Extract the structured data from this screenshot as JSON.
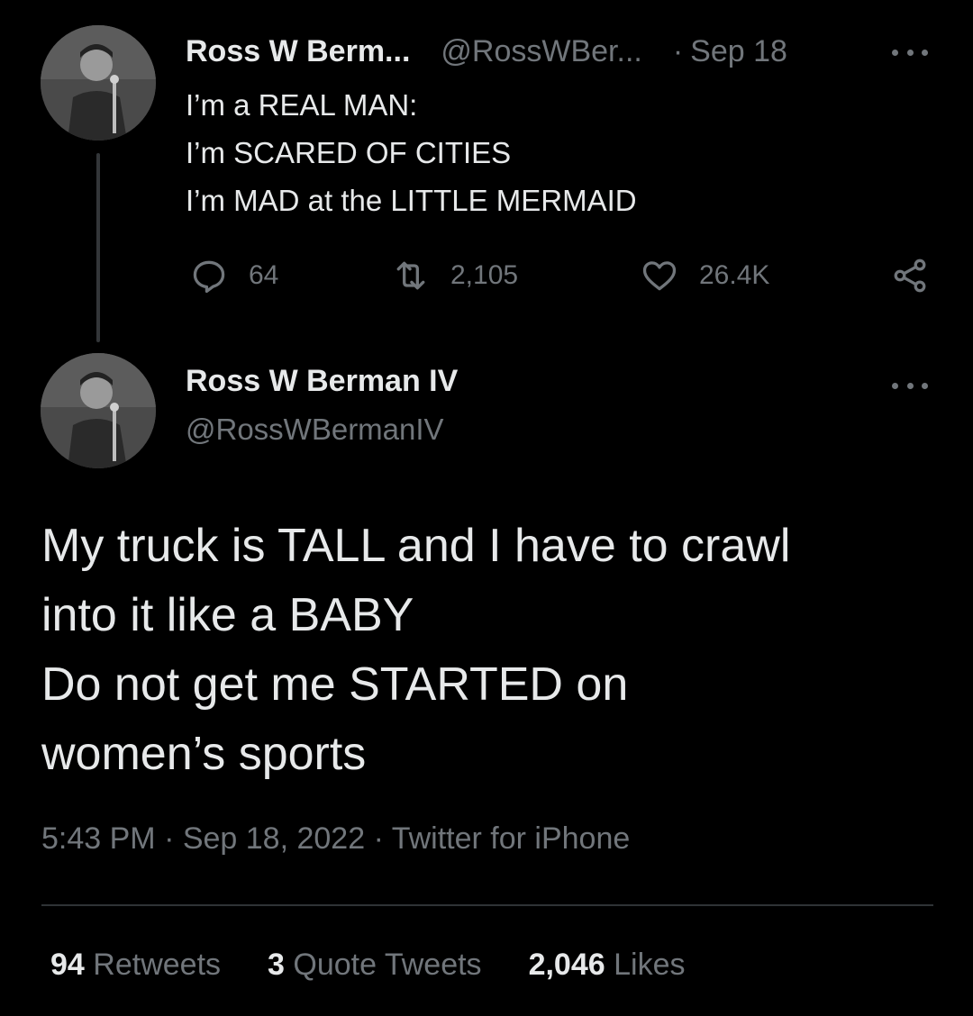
{
  "parent_tweet": {
    "display_name": "Ross W Berm...",
    "handle": "@RossWBer...",
    "separator": "·",
    "date": "Sep 18",
    "lines": [
      "I’m a REAL MAN:",
      "I’m SCARED OF CITIES",
      "I’m MAD at the LITTLE MERMAID"
    ],
    "replies": "64",
    "retweets": "2,105",
    "likes": "26.4K"
  },
  "main_tweet": {
    "display_name": "Ross W Berman IV",
    "handle": "@RossWBermanIV",
    "lines": [
      "My truck is TALL and I have to crawl",
      "into it like a BABY",
      "Do not get me STARTED on",
      "women’s sports"
    ],
    "timestamp": "5:43 PM · Sep 18, 2022 · Twitter for iPhone",
    "stats": {
      "retweets_count": "94",
      "retweets_label": "Retweets",
      "quotes_count": "3",
      "quotes_label": "Quote Tweets",
      "likes_count": "2,046",
      "likes_label": "Likes"
    }
  },
  "icons": {
    "reply": "reply-icon",
    "retweet": "retweet-icon",
    "like": "heart-icon",
    "share": "share-icon",
    "more": "more-icon"
  },
  "colors": {
    "background": "#000000",
    "primary_text": "#e7e9ea",
    "secondary_text": "#71767b",
    "divider": "#2f3336"
  }
}
